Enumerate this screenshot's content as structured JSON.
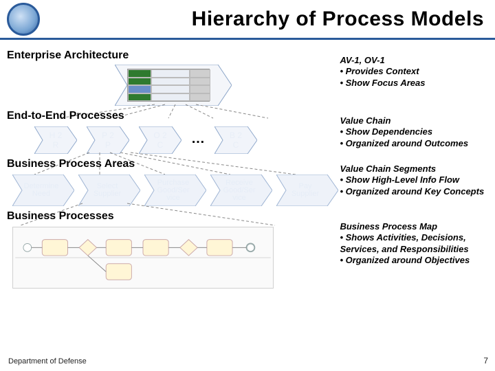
{
  "header": {
    "title": "Hierarchy of Process Models"
  },
  "footer": {
    "org": "Department of Defense",
    "page": "7"
  },
  "sections": {
    "ea": {
      "label": "Enterprise Architecture"
    },
    "e2e": {
      "label": "End-to-End Processes"
    },
    "bpa": {
      "label": "Business Process Areas"
    },
    "bp": {
      "label": "Business Processes"
    }
  },
  "e2e_chevrons": {
    "items": [
      {
        "line1": "H 2",
        "line2": "R"
      },
      {
        "line1": "P 2",
        "line2": "P"
      },
      {
        "line1": "O 2",
        "line2": "C"
      },
      {
        "line1": "B 2",
        "line2": "C"
      }
    ],
    "ellipsis": "…"
  },
  "bpa_chevrons": {
    "items": [
      {
        "label": "Determine\nNeed"
      },
      {
        "label": "Select\nSupplier"
      },
      {
        "label": "Purchase\nGood/Ser\nvice"
      },
      {
        "label": "Receive\nGood/Ser\nvice"
      },
      {
        "label": "Pay\nSupplier"
      }
    ]
  },
  "descriptions": {
    "ea": {
      "title": "AV-1, OV-1",
      "bullets": [
        "Provides Context",
        "Show Focus Areas"
      ]
    },
    "e2e": {
      "title": "Value Chain",
      "bullets": [
        "Show Dependencies",
        "Organized around Outcomes"
      ]
    },
    "bpa": {
      "title": "Value Chain Segments",
      "bullets": [
        "Show High-Level Info Flow",
        "Organized around Key Concepts"
      ]
    },
    "bp": {
      "title": "Business Process Map",
      "bullets": [
        "Shows Activities, Decisions, Services, and Responsibilities",
        "Organized around Objectives"
      ]
    }
  }
}
